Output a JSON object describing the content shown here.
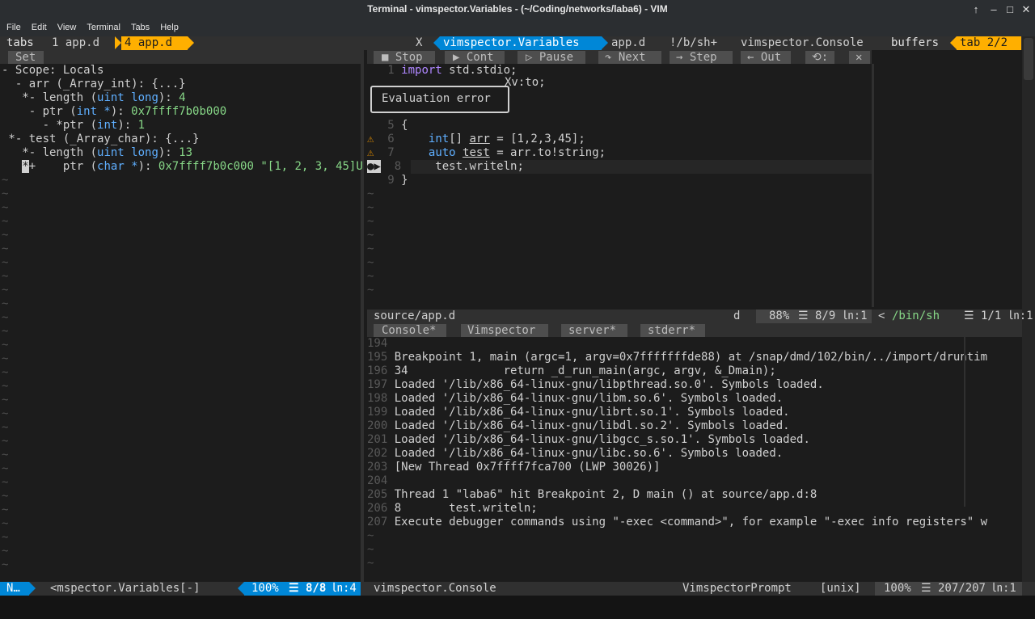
{
  "window": {
    "title": "Terminal - vimspector.Variables - (~/Coding/networks/laba6) - VIM",
    "controls": [
      "↑",
      "–",
      "□",
      "✕"
    ]
  },
  "menu": [
    "File",
    "Edit",
    "View",
    "Terminal",
    "Tabs",
    "Help"
  ],
  "tabline": {
    "tabs_label": "tabs",
    "tab1": "1 app.d",
    "tab4": "4 app.d",
    "close": "X",
    "buf_active": "vimspector.Variables",
    "buf2": "app.d",
    "buf3": "!/b/sh+",
    "buf4": "vimspector.Console",
    "buffers_label": "buffers",
    "tab_count": "tab 2/2"
  },
  "variables": {
    "set_button": "Set",
    "lines": [
      "- Scope: Locals",
      "  - arr (_Array_int): {...}",
      "   *- length (",
      "    - ptr (",
      "      - *ptr (",
      " *- test (_Array_char): {...}",
      "   *- length (",
      "    ptr ("
    ],
    "types": [
      "uint long",
      "int *",
      "int",
      "uint long",
      "char *"
    ],
    "values": [
      "4",
      "0x7ffff7b0b000",
      "1",
      "13",
      "0x7ffff7b0c000",
      "\"[1, 2, 3, 45]U"
    ],
    "cursor_char": "*",
    "plus_char": "+"
  },
  "toolbar": {
    "stop": "■ Stop",
    "cont": "▶ Cont",
    "pause": "▷ Pause",
    "next": "↷ Next",
    "step": "→ Step",
    "out": "← Out",
    "restart": "⟲:",
    "close": "✕"
  },
  "code": {
    "lines": [
      {
        "n": "1",
        "kw": "import",
        "rest": " std.stdio;"
      },
      {
        "n": "5",
        "text": "{"
      },
      {
        "n": "6",
        "ty": "int",
        "a": "[] ",
        "var": "arr",
        "b": " = [1,2,3,45];"
      },
      {
        "n": "7",
        "ty": "auto",
        "a": " ",
        "var": "test",
        "b": " = arr.to!string;"
      },
      {
        "n": "8",
        "text": "    test.writeln;"
      },
      {
        "n": "9",
        "text": "}"
      }
    ],
    "popup_title": "Xv:to;",
    "popup_text": "Evaluation error",
    "warn_sign": "⚠",
    "bp_sign": "●▶"
  },
  "code_status": {
    "file": "source/app.d",
    "ft": "d",
    "pct": "88%",
    "pos": "☰ 8/9 ㏑:1"
  },
  "shell_status": {
    "name": "/bin/sh",
    "pos": "☰ 1/1 ㏑:1"
  },
  "console_tabs": [
    "Console*",
    "Vimspector",
    "server*",
    "stderr*"
  ],
  "console": {
    "lines": [
      {
        "n": "194",
        "t": ""
      },
      {
        "n": "195",
        "t": "Breakpoint 1, main (argc=1, argv=0x7fffffffde88) at /snap/dmd/102/bin/../import/druntim"
      },
      {
        "n": "196",
        "t": "34              return _d_run_main(argc, argv, &_Dmain);"
      },
      {
        "n": "197",
        "t": "Loaded '/lib/x86_64-linux-gnu/libpthread.so.0'. Symbols loaded."
      },
      {
        "n": "198",
        "t": "Loaded '/lib/x86_64-linux-gnu/libm.so.6'. Symbols loaded."
      },
      {
        "n": "199",
        "t": "Loaded '/lib/x86_64-linux-gnu/librt.so.1'. Symbols loaded."
      },
      {
        "n": "200",
        "t": "Loaded '/lib/x86_64-linux-gnu/libdl.so.2'. Symbols loaded."
      },
      {
        "n": "201",
        "t": "Loaded '/lib/x86_64-linux-gnu/libgcc_s.so.1'. Symbols loaded."
      },
      {
        "n": "202",
        "t": "Loaded '/lib/x86_64-linux-gnu/libc.so.6'. Symbols loaded."
      },
      {
        "n": "203",
        "t": "[New Thread 0x7ffff7fca700 (LWP 30026)]"
      },
      {
        "n": "204",
        "t": ""
      },
      {
        "n": "205",
        "t": "Thread 1 \"laba6\" hit Breakpoint 2, D main () at source/app.d:8"
      },
      {
        "n": "206",
        "t": "8       test.writeln;"
      },
      {
        "n": "207",
        "t": "Execute debugger commands using \"-exec <command>\", for example \"-exec info registers\" w"
      }
    ]
  },
  "bottom_status": {
    "mode": "N…",
    "left_name": "<mspector.Variables[-]",
    "left_pct": "100%",
    "left_pos": "☰ 8/8",
    "left_col": "㏑:4",
    "right_name": "vimspector.Console",
    "right_ft": "VimspectorPrompt",
    "right_enc": "[unix]",
    "right_pct": "100%",
    "right_pos": "☰ 207/207",
    "right_col": "㏑:1"
  },
  "tilde": "~",
  "colors": {
    "accent_orange": "#ffaf00",
    "accent_blue": "#0087d7",
    "background": "#1c1c1c",
    "button_bg": "#4e4e4e"
  }
}
